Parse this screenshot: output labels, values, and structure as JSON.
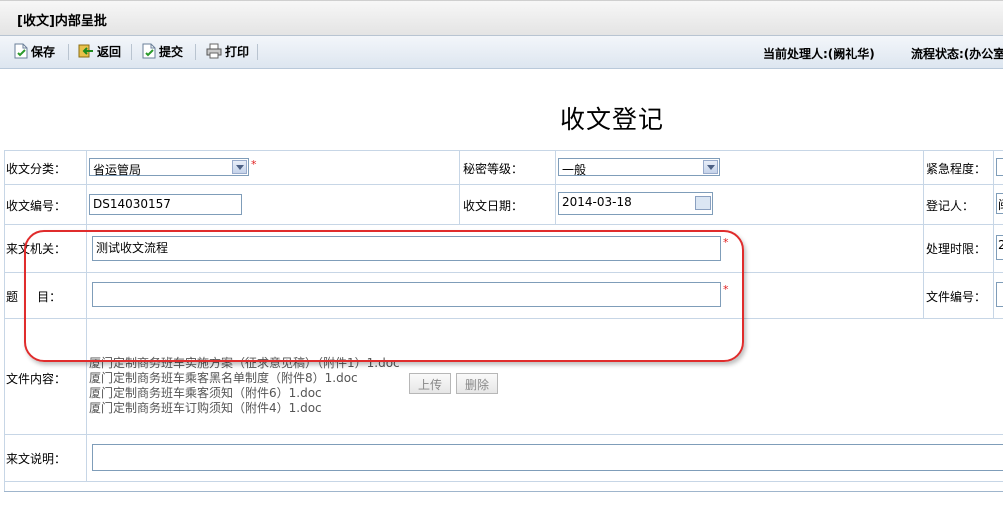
{
  "window": {
    "title": "[收文]内部呈批"
  },
  "toolbar": {
    "save_label": "保存",
    "return_label": "返回",
    "submit_label": "提交",
    "print_label": "打印",
    "current_handler": "当前处理人:(阙礼华)",
    "flow_status": "流程状态:(办公室"
  },
  "form": {
    "heading": "收文登记",
    "category_label": "收文分类：",
    "category_value": "省运管局",
    "secret_label": "秘密等级：",
    "secret_value": "一般",
    "urgency_label": "紧急程度：",
    "number_label": "收文编号：",
    "number_value": "DS14030157",
    "date_label": "收文日期：",
    "date_value": "2014-03-18",
    "registrar_label": "登记人：",
    "registrar_value": "闽",
    "source_label": "来文机关：",
    "source_value": "测试收文流程",
    "deadline_label": "处理时限：",
    "deadline_value": "2",
    "subject_label": "题     目：",
    "subject_value": "",
    "doc_number_label": "文件编号：",
    "content_label": "文件内容：",
    "attachments": [
      "厦门定制商务班车实施方案（征求意见稿）（附件1）1.doc",
      "厦门定制商务班车乘客黑名单制度（附件8）1.doc",
      "厦门定制商务班车乘客须知（附件6）1.doc",
      "厦门定制商务班车订购须知（附件4）1.doc"
    ],
    "upload_label": "上传",
    "delete_label": "删除",
    "description_label": "来文说明：",
    "required_mark": "*"
  }
}
